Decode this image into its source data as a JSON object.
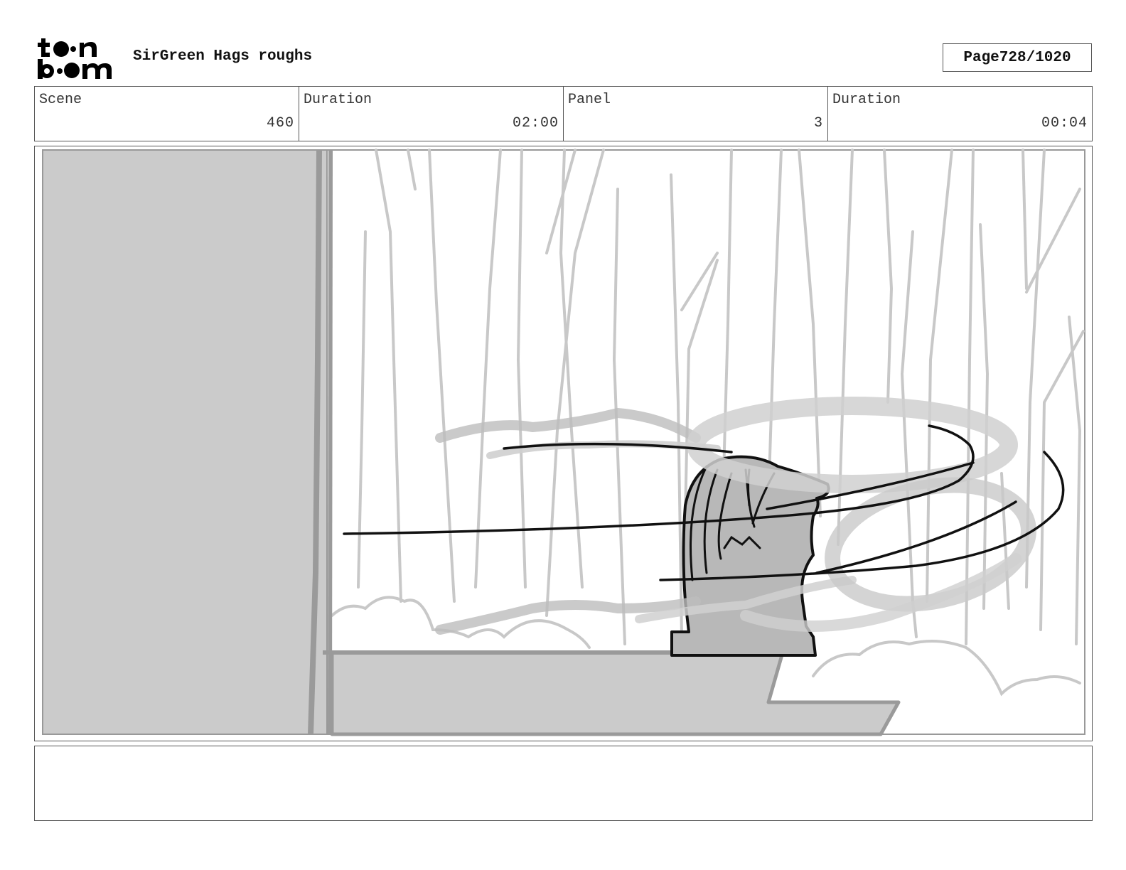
{
  "header": {
    "logo_text": "toon boom",
    "title": "SirGreen Hags roughs",
    "page_label": "Page",
    "page_value": "728/1020"
  },
  "info": {
    "scene_label": "Scene",
    "scene_value": "460",
    "duration_label": "Duration",
    "duration_value": "02:00",
    "panel_label": "Panel",
    "panel_value": "3",
    "panel_duration_label": "Duration",
    "panel_duration_value": "00:04"
  },
  "notes": {
    "text": ""
  }
}
